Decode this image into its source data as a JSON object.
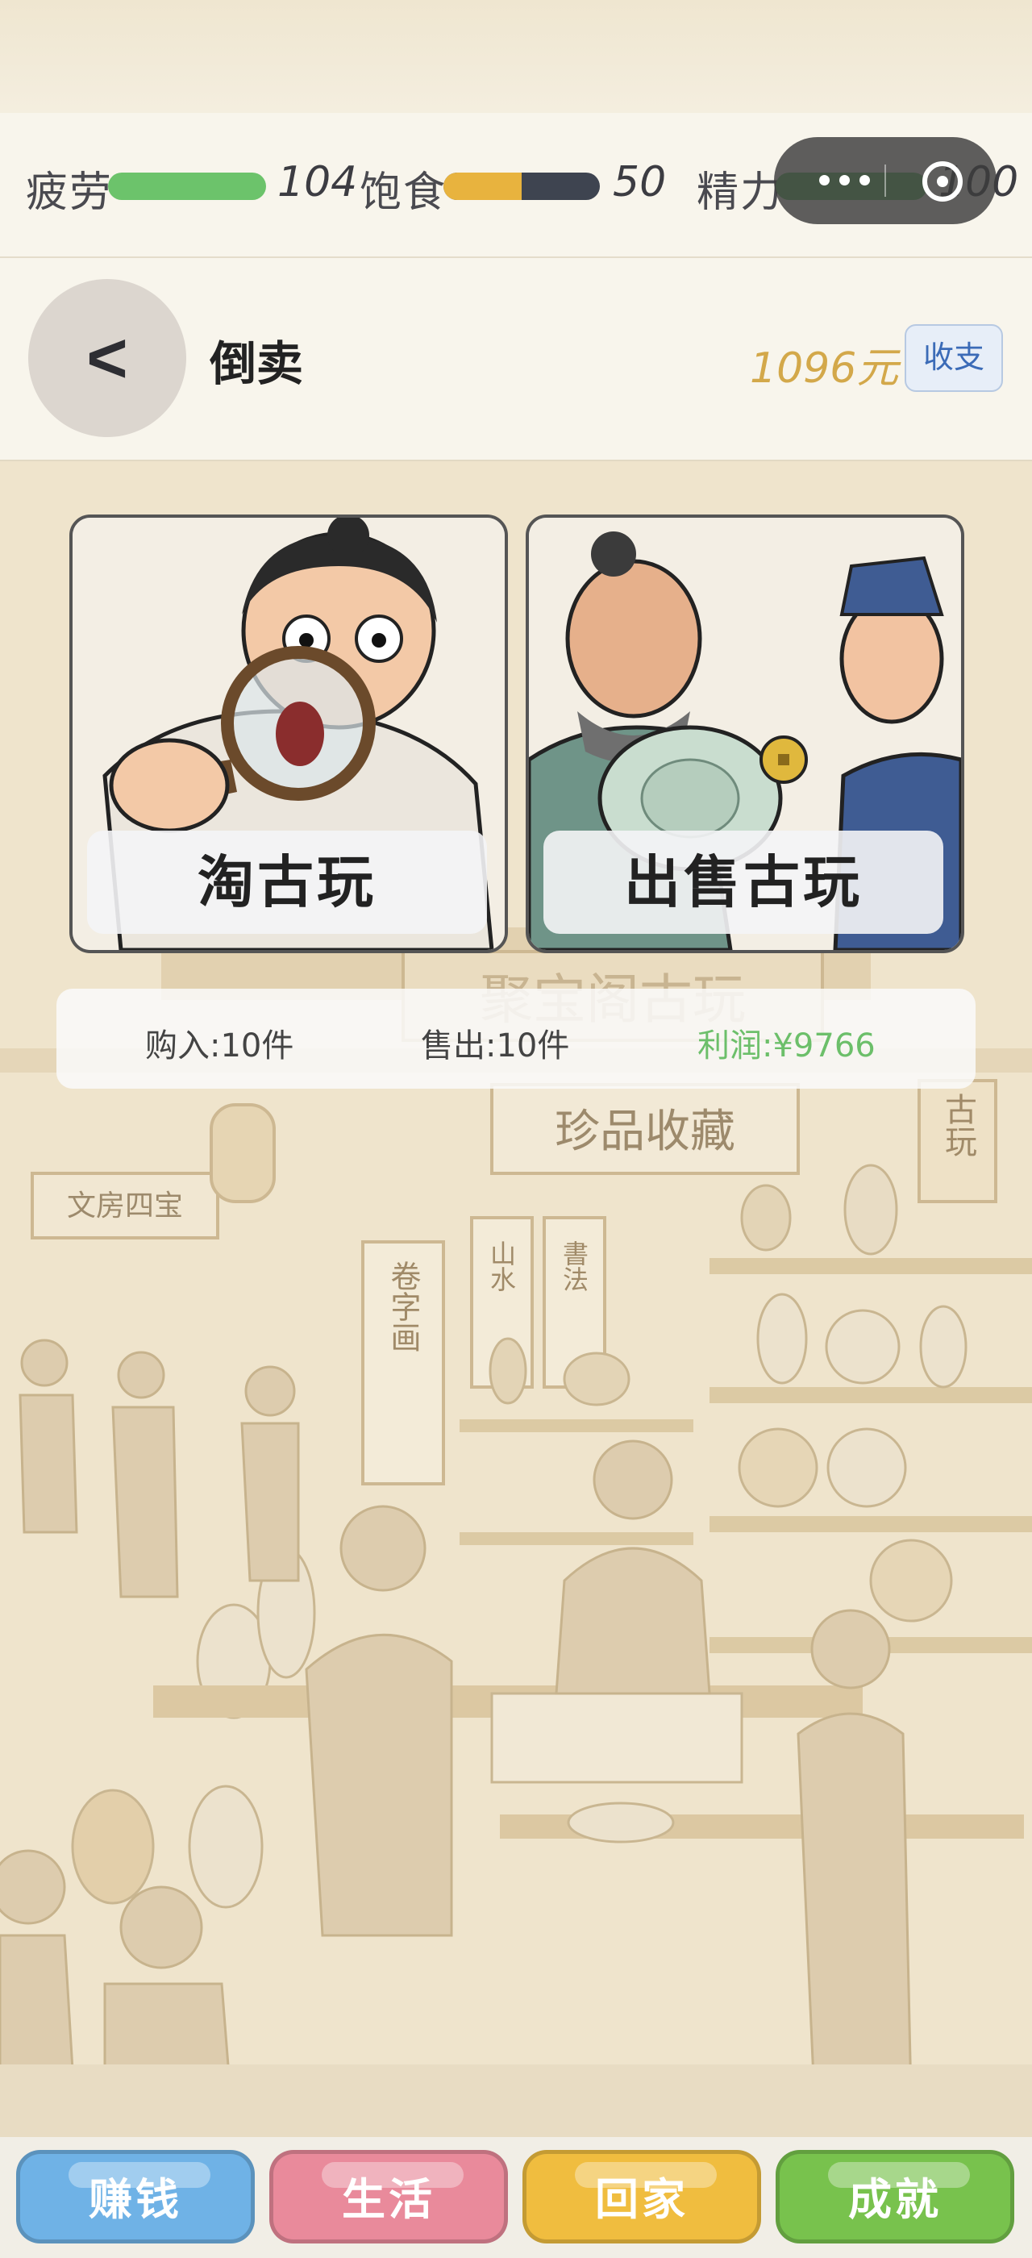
{
  "status": {
    "fatigue": {
      "label": "疲劳",
      "value": "104",
      "level": 1.0,
      "color": "#6cc36b"
    },
    "satiety": {
      "label": "饱食",
      "value": "50",
      "level": 0.5,
      "color": "#e8b33e"
    },
    "energy": {
      "label": "精力",
      "value": "100",
      "level": 1.0,
      "color": "#6cc36b"
    }
  },
  "header": {
    "back_icon": "<",
    "title": "倒卖",
    "money": "1096元",
    "ledger_label": "收支"
  },
  "actions": {
    "browse_label": "淘古玩",
    "sell_label": "出售古玩"
  },
  "stats": {
    "bought": "购入:10件",
    "sold": "售出:10件",
    "profit": "利润:¥9766",
    "profit_color": "#6cbf6a"
  },
  "scene_signs": {
    "shop_sign": "聚宝阁古玩",
    "treasure": "珍品收藏",
    "stationery": "文房四宝",
    "antique": "古玩",
    "scroll_1": "卷字画",
    "scroll_2": "山水",
    "scroll_3": "書法"
  },
  "nav": {
    "earn": "赚钱",
    "life": "生活",
    "home": "回家",
    "achievement": "成就",
    "colors": [
      "#6fb2e6",
      "#e98a9b",
      "#f0bd3f",
      "#78c24d"
    ]
  }
}
